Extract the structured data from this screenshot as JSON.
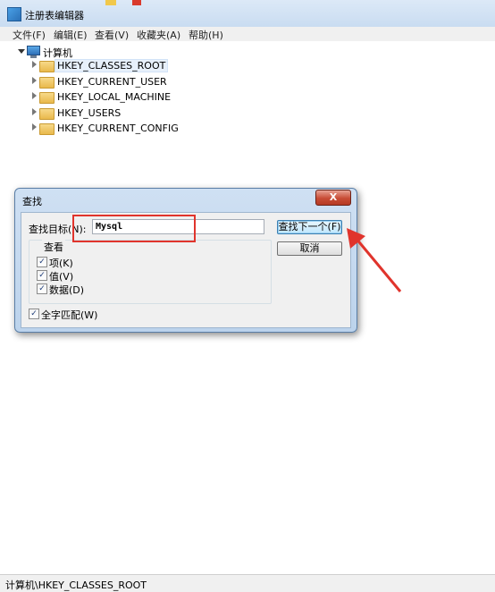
{
  "window": {
    "title": "注册表编辑器"
  },
  "menu": [
    "文件(F)",
    "编辑(E)",
    "查看(V)",
    "收藏夹(A)",
    "帮助(H)"
  ],
  "tree": {
    "root": "计算机",
    "children": [
      "HKEY_CLASSES_ROOT",
      "HKEY_CURRENT_USER",
      "HKEY_LOCAL_MACHINE",
      "HKEY_USERS",
      "HKEY_CURRENT_CONFIG"
    ]
  },
  "find_dialog": {
    "title": "查找",
    "close_label": "X",
    "find_what_label": "查找目标(N):",
    "find_what_value": "Mysql",
    "look_at_label": "查看",
    "options": [
      {
        "label": "项(K)",
        "checked": true
      },
      {
        "label": "值(V)",
        "checked": true
      },
      {
        "label": "数据(D)",
        "checked": true
      }
    ],
    "match_whole": {
      "label": "全字匹配(W)",
      "checked": true
    },
    "find_next_label": "查找下一个(F)",
    "cancel_label": "取消",
    "check_glyph": "✓"
  },
  "statusbar": {
    "path": "计算机\\HKEY_CLASSES_ROOT"
  },
  "colors": {
    "annotation": "#e0342c",
    "selection": "#e7f0fb"
  }
}
